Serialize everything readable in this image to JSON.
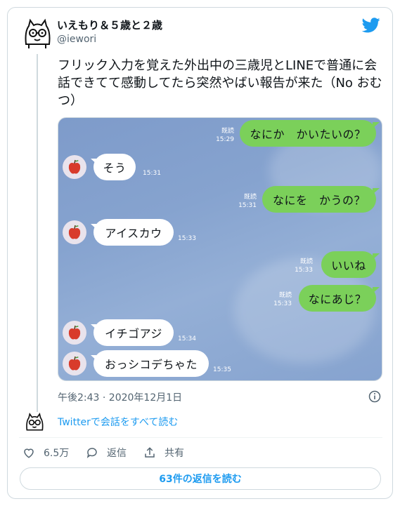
{
  "tweet": {
    "author_name": "いえもり＆５歳と２歳",
    "handle": "@iewori",
    "text": "フリック入力を覚えた外出中の三歳児とLINEで普通に会話できてて感動してたら突然やばい報告が来た（No おむつ）",
    "timestamp": "午後2:43 · 2020年12月1日",
    "read_thread_label": "Twitterで会話をすべて読む",
    "likes_label": "6.5万",
    "reply_label": "返信",
    "share_label": "共有",
    "read_replies_label": "63件の返信を読む"
  },
  "chat": {
    "messages": [
      {
        "side": "right",
        "text": "なにか　かいたいの？",
        "read": "既読",
        "time": "15:29"
      },
      {
        "side": "left",
        "text": "そう",
        "time": "15:31"
      },
      {
        "side": "right",
        "text": "なにを　かうの？",
        "read": "既読",
        "time": "15:31"
      },
      {
        "side": "left",
        "text": "アイスカウ",
        "time": "15:33"
      },
      {
        "side": "right",
        "text": "いいね",
        "read": "既読",
        "time": "15:33"
      },
      {
        "side": "right",
        "text": "なにあじ？",
        "read": "既読",
        "time": "15:33"
      },
      {
        "side": "left",
        "text": "イチゴアジ",
        "time": "15:34"
      },
      {
        "side": "left",
        "text": "おっシコデちゃた",
        "time": "15:35"
      }
    ]
  },
  "colors": {
    "accent": "#1d9bf0",
    "line_green": "#7bd05a",
    "chat_bg": "#86a3cf"
  },
  "icons": [
    "avatar-icon",
    "twitter-bird-icon",
    "info-icon",
    "heart-icon",
    "reply-icon",
    "share-icon",
    "apple-icon"
  ]
}
